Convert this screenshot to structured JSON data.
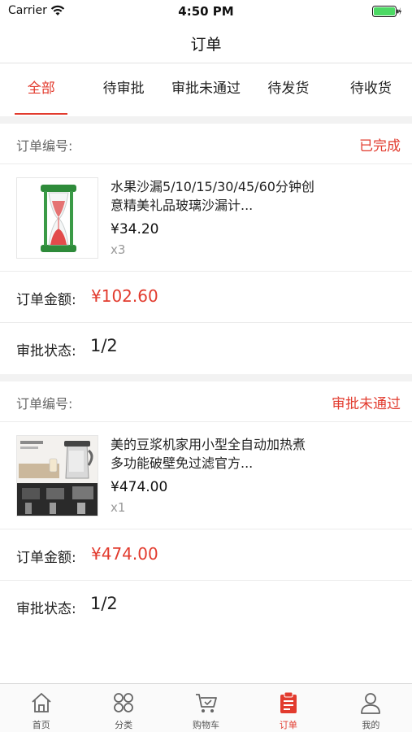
{
  "status_bar": {
    "carrier": "Carrier",
    "time": "4:50 PM"
  },
  "nav": {
    "title": "订单"
  },
  "tabs": [
    {
      "label": "全部",
      "active": true
    },
    {
      "label": "待审批",
      "active": false
    },
    {
      "label": "审批未通过",
      "active": false
    },
    {
      "label": "待发货",
      "active": false
    },
    {
      "label": "待收货",
      "active": false
    }
  ],
  "orders": [
    {
      "number_label": "订单编号:",
      "status": "已完成",
      "product": {
        "name": "水果沙漏5/10/15/30/45/60分钟创意精美礼品玻璃沙漏计...",
        "price": "¥34.20",
        "qty": "x3",
        "thumb_icon": "hourglass-image"
      },
      "amount_label": "订单金额:",
      "amount": "¥102.60",
      "approval_label": "审批状态:",
      "approval": "1/2"
    },
    {
      "number_label": "订单编号:",
      "status": "审批未通过",
      "product": {
        "name": "美的豆浆机家用小型全自动加热煮多功能破壁免过滤官方...",
        "price": "¥474.00",
        "qty": "x1",
        "thumb_icon": "soymilk-maker-image"
      },
      "amount_label": "订单金额:",
      "amount": "¥474.00",
      "approval_label": "审批状态:",
      "approval": "1/2"
    }
  ],
  "tabbar": [
    {
      "label": "首页",
      "icon": "home-icon",
      "active": false
    },
    {
      "label": "分类",
      "icon": "category-icon",
      "active": false
    },
    {
      "label": "购物车",
      "icon": "cart-icon",
      "active": false
    },
    {
      "label": "订单",
      "icon": "order-icon",
      "active": true
    },
    {
      "label": "我的",
      "icon": "profile-icon",
      "active": false
    }
  ],
  "colors": {
    "accent": "#e23b2e",
    "battery": "#4cd964",
    "background_gap": "#f2f2f2"
  }
}
